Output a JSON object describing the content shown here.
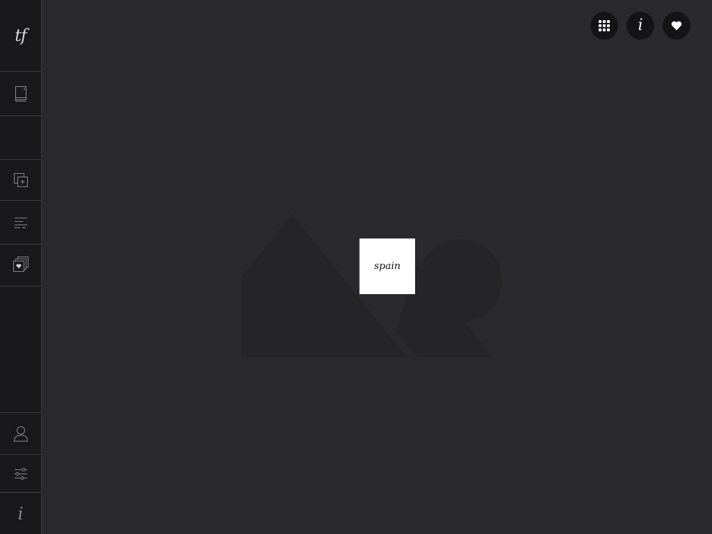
{
  "sidebar": {
    "logo": "tf",
    "items": [
      {
        "icon": "book-icon"
      },
      {
        "icon": "empty-slot"
      },
      {
        "icon": "add-layer-icon"
      },
      {
        "icon": "text-lines-icon"
      },
      {
        "icon": "favorites-stack-icon"
      }
    ],
    "bottom_items": [
      {
        "icon": "user-icon"
      },
      {
        "icon": "sliders-icon"
      },
      {
        "icon": "info-icon",
        "glyph": "i"
      }
    ]
  },
  "top_actions": [
    {
      "icon": "grid-icon"
    },
    {
      "icon": "info-icon",
      "glyph": "i"
    },
    {
      "icon": "heart-icon"
    }
  ],
  "content": {
    "placeholder_icon": "image-placeholder-icon",
    "badge_text": "spain"
  },
  "colors": {
    "background": "#2a292e",
    "sidebar": "#19191b",
    "button": "#141416",
    "placeholder": "#252427",
    "badge": "#ffffff"
  }
}
